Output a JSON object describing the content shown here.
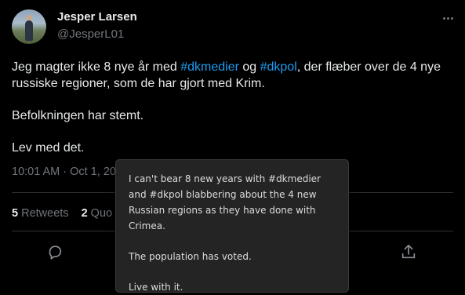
{
  "tweet": {
    "author_name": "Jesper Larsen",
    "author_handle": "@JesperL01",
    "paragraph1": {
      "t1": "Jeg magter ikke 8 nye år med ",
      "tag1": "#dkmedier",
      "t2": " og ",
      "tag2": "#dkpol",
      "t3": ", der flæber over de 4 nye russiske regioner, som de har gjort med Krim."
    },
    "paragraph2": "Befolkningen har stemt.",
    "paragraph3": "Lev med det.",
    "timestamp": "10:01 AM · Oct 1, 20"
  },
  "stats": {
    "retweets_count": "5",
    "retweets_label": "Retweets",
    "quotes_count": "2",
    "quotes_label": "Quo"
  },
  "translation_tooltip": {
    "line1": "I can't bear 8 new years with #dkmedier and #dkpol blabbering about the 4 new Russian regions as they have done with Crimea.",
    "line2": "The population has voted.",
    "line3": "Live with it."
  },
  "icons": {
    "more": "more-horizontal-icon",
    "reply": "reply-icon",
    "share": "share-icon"
  },
  "colors": {
    "background": "#000000",
    "text": "#e7e9ea",
    "secondary": "#71767b",
    "link": "#1d9bf0",
    "tooltip_bg": "#242424"
  }
}
